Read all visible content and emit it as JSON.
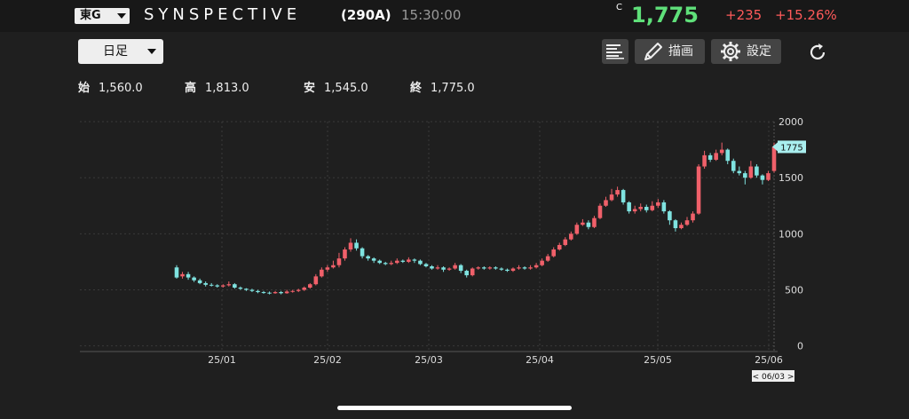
{
  "header": {
    "market": "東G",
    "name": "SYNSPECTIVE",
    "code": "(290A)",
    "time": "15:30:00",
    "price_flag": "C",
    "price": "1,775",
    "change": "+235",
    "change_pct": "+15.26%"
  },
  "toolbar": {
    "period": "日足",
    "draw_label": "描画",
    "settings_label": "設定"
  },
  "ohlc": {
    "open_label": "始",
    "open": "1,560.0",
    "high_label": "高",
    "high": "1,813.0",
    "low_label": "安",
    "low": "1,545.0",
    "close_label": "終",
    "close": "1,775.0"
  },
  "chart_data": {
    "type": "candlestick",
    "y_ticks": [
      0,
      500,
      1000,
      1500,
      2000
    ],
    "ylim": [
      0,
      2000
    ],
    "x_ticks": [
      "25/01",
      "25/02",
      "25/03",
      "25/04",
      "25/05",
      "25/06"
    ],
    "last_price_label": "1775",
    "cursor_label": "< 06/03 >",
    "colors": {
      "up": "#f0606a",
      "down": "#7fe3e0",
      "grid": "#3a3a3a",
      "axis": "#555555",
      "label_bg": "#a9eeee"
    },
    "candles": [
      [
        700,
        610,
        720,
        600
      ],
      [
        620,
        640,
        660,
        600
      ],
      [
        640,
        610,
        660,
        590
      ],
      [
        610,
        585,
        620,
        570
      ],
      [
        585,
        560,
        600,
        550
      ],
      [
        560,
        545,
        575,
        530
      ],
      [
        545,
        540,
        560,
        530
      ],
      [
        540,
        530,
        550,
        520
      ],
      [
        530,
        540,
        550,
        520
      ],
      [
        540,
        550,
        575,
        530
      ],
      [
        550,
        520,
        560,
        510
      ],
      [
        520,
        510,
        530,
        500
      ],
      [
        510,
        500,
        515,
        490
      ],
      [
        500,
        490,
        510,
        480
      ],
      [
        490,
        480,
        500,
        470
      ],
      [
        480,
        475,
        490,
        465
      ],
      [
        475,
        470,
        485,
        460
      ],
      [
        470,
        480,
        490,
        465
      ],
      [
        480,
        470,
        490,
        460
      ],
      [
        470,
        485,
        500,
        465
      ],
      [
        485,
        490,
        500,
        475
      ],
      [
        490,
        500,
        510,
        480
      ],
      [
        500,
        520,
        530,
        490
      ],
      [
        520,
        550,
        560,
        510
      ],
      [
        550,
        620,
        640,
        540
      ],
      [
        620,
        680,
        700,
        610
      ],
      [
        680,
        700,
        720,
        660
      ],
      [
        700,
        720,
        760,
        690
      ],
      [
        720,
        780,
        830,
        700
      ],
      [
        780,
        860,
        880,
        760
      ],
      [
        860,
        920,
        960,
        840
      ],
      [
        920,
        870,
        950,
        850
      ],
      [
        870,
        800,
        880,
        780
      ],
      [
        800,
        780,
        810,
        760
      ],
      [
        780,
        760,
        790,
        740
      ],
      [
        760,
        740,
        770,
        730
      ],
      [
        740,
        730,
        750,
        720
      ],
      [
        730,
        740,
        760,
        720
      ],
      [
        740,
        760,
        780,
        730
      ],
      [
        760,
        750,
        770,
        740
      ],
      [
        750,
        770,
        790,
        740
      ],
      [
        770,
        760,
        780,
        740
      ],
      [
        760,
        730,
        770,
        720
      ],
      [
        730,
        710,
        740,
        700
      ],
      [
        710,
        690,
        720,
        680
      ],
      [
        690,
        700,
        720,
        680
      ],
      [
        700,
        680,
        710,
        660
      ],
      [
        680,
        690,
        700,
        670
      ],
      [
        690,
        720,
        740,
        680
      ],
      [
        720,
        670,
        730,
        650
      ],
      [
        670,
        630,
        680,
        610
      ],
      [
        630,
        690,
        700,
        620
      ],
      [
        690,
        700,
        710,
        680
      ],
      [
        700,
        690,
        710,
        680
      ],
      [
        690,
        700,
        710,
        680
      ],
      [
        700,
        690,
        710,
        680
      ],
      [
        690,
        680,
        700,
        670
      ],
      [
        680,
        670,
        690,
        660
      ],
      [
        670,
        690,
        700,
        660
      ],
      [
        690,
        700,
        720,
        680
      ],
      [
        700,
        690,
        710,
        680
      ],
      [
        690,
        700,
        720,
        680
      ],
      [
        700,
        720,
        740,
        690
      ],
      [
        720,
        760,
        780,
        710
      ],
      [
        760,
        800,
        820,
        750
      ],
      [
        800,
        860,
        880,
        790
      ],
      [
        860,
        900,
        920,
        850
      ],
      [
        900,
        950,
        970,
        890
      ],
      [
        950,
        1000,
        1020,
        940
      ],
      [
        1000,
        1080,
        1100,
        990
      ],
      [
        1080,
        1100,
        1130,
        1070
      ],
      [
        1100,
        1060,
        1120,
        1040
      ],
      [
        1060,
        1140,
        1160,
        1050
      ],
      [
        1140,
        1250,
        1270,
        1130
      ],
      [
        1250,
        1300,
        1330,
        1240
      ],
      [
        1300,
        1350,
        1400,
        1290
      ],
      [
        1350,
        1390,
        1420,
        1330
      ],
      [
        1390,
        1280,
        1400,
        1260
      ],
      [
        1280,
        1200,
        1290,
        1180
      ],
      [
        1200,
        1220,
        1250,
        1180
      ],
      [
        1220,
        1240,
        1270,
        1200
      ],
      [
        1240,
        1210,
        1260,
        1190
      ],
      [
        1210,
        1250,
        1290,
        1200
      ],
      [
        1250,
        1280,
        1310,
        1230
      ],
      [
        1280,
        1200,
        1300,
        1180
      ],
      [
        1200,
        1120,
        1210,
        1080
      ],
      [
        1120,
        1050,
        1130,
        1020
      ],
      [
        1050,
        1080,
        1100,
        1040
      ],
      [
        1080,
        1120,
        1150,
        1070
      ],
      [
        1120,
        1180,
        1200,
        1100
      ],
      [
        1180,
        1600,
        1620,
        1170
      ],
      [
        1600,
        1700,
        1740,
        1580
      ],
      [
        1700,
        1660,
        1720,
        1640
      ],
      [
        1660,
        1720,
        1750,
        1650
      ],
      [
        1720,
        1750,
        1813,
        1700
      ],
      [
        1750,
        1650,
        1760,
        1620
      ],
      [
        1650,
        1560,
        1670,
        1540
      ],
      [
        1560,
        1540,
        1600,
        1520
      ],
      [
        1540,
        1500,
        1560,
        1440
      ],
      [
        1500,
        1600,
        1650,
        1490
      ],
      [
        1600,
        1520,
        1620,
        1500
      ],
      [
        1520,
        1480,
        1530,
        1440
      ],
      [
        1480,
        1540,
        1560,
        1470
      ],
      [
        1560,
        1775,
        1813,
        1545
      ]
    ]
  }
}
